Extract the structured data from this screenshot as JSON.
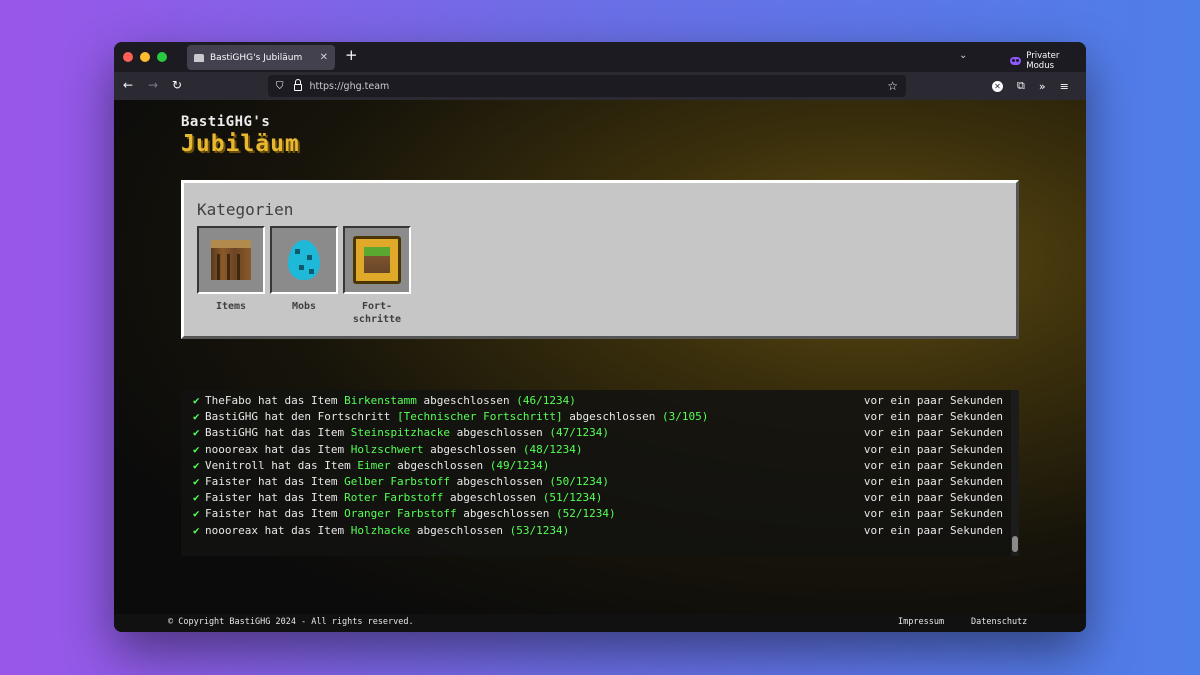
{
  "browser": {
    "tab_title": "BastiGHG's Jubiläum",
    "private_label": "Privater Modus",
    "url": "https://ghg.team"
  },
  "site": {
    "brand_top": "BastiGHG's",
    "brand_main": "Jubiläum"
  },
  "categories": {
    "title": "Kategorien",
    "items": [
      {
        "label": "Items",
        "icon": "oak-log-icon"
      },
      {
        "label": "Mobs",
        "icon": "spawn-egg-icon"
      },
      {
        "label": "Fort-\nschritte",
        "icon": "grass-block-advancement-icon"
      }
    ]
  },
  "feed": [
    {
      "pre": "TheFabo hat das Item ",
      "name": "Birkenstamm",
      "post": " abgeschlossen ",
      "count": "(46/1234)",
      "time": "vor ein paar Sekunden"
    },
    {
      "pre": "BastiGHG hat den Fortschritt ",
      "name": "[Technischer Fortschritt]",
      "post": " abgeschlossen ",
      "count": "(3/105)",
      "time": "vor ein paar Sekunden"
    },
    {
      "pre": "BastiGHG hat das Item ",
      "name": "Steinspitzhacke",
      "post": " abgeschlossen ",
      "count": "(47/1234)",
      "time": "vor ein paar Sekunden"
    },
    {
      "pre": "noooreax hat das Item ",
      "name": "Holzschwert",
      "post": " abgeschlossen ",
      "count": "(48/1234)",
      "time": "vor ein paar Sekunden"
    },
    {
      "pre": "Venitroll hat das Item ",
      "name": "Eimer",
      "post": " abgeschlossen ",
      "count": "(49/1234)",
      "time": "vor ein paar Sekunden"
    },
    {
      "pre": "Faister hat das Item ",
      "name": "Gelber Farbstoff",
      "post": " abgeschlossen ",
      "count": "(50/1234)",
      "time": "vor ein paar Sekunden"
    },
    {
      "pre": "Faister hat das Item ",
      "name": "Roter Farbstoff",
      "post": " abgeschlossen ",
      "count": "(51/1234)",
      "time": "vor ein paar Sekunden"
    },
    {
      "pre": "Faister hat das Item ",
      "name": "Oranger Farbstoff",
      "post": " abgeschlossen ",
      "count": "(52/1234)",
      "time": "vor ein paar Sekunden"
    },
    {
      "pre": "noooreax hat das Item ",
      "name": "Holzhacke",
      "post": " abgeschlossen ",
      "count": "(53/1234)",
      "time": "vor ein paar Sekunden"
    }
  ],
  "footer": {
    "copyright": "© Copyright BastiGHG 2024 - All rights reserved.",
    "impressum": "Impressum",
    "datenschutz": "Datenschutz"
  },
  "colors": {
    "accent_gold": "#e8b830",
    "item_green": "#55ff55",
    "panel_gray": "#c6c6c6"
  }
}
